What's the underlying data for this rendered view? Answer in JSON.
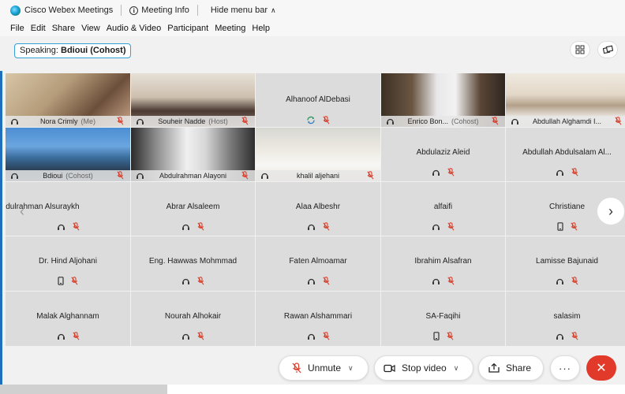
{
  "window": {
    "app_title": "Cisco Webex Meetings",
    "meeting_info_label": "Meeting Info",
    "hide_menu_label": "Hide menu bar"
  },
  "menu": {
    "items": [
      "File",
      "Edit",
      "Share",
      "View",
      "Audio & Video",
      "Participant",
      "Meeting",
      "Help"
    ]
  },
  "speaking": {
    "prefix": "Speaking:",
    "name": "Bdioui (Cohost)"
  },
  "participants": [
    {
      "name": "Nora Crimly",
      "role": "(Me)",
      "video": true,
      "left_icon": "audio-icon"
    },
    {
      "name": "Souheir Nadde",
      "role": "(Host)",
      "video": true,
      "left_icon": "audio-icon"
    },
    {
      "name": "Alhanoof AlDebasi",
      "role": "",
      "video": false,
      "device": "sync-icon"
    },
    {
      "name": "Enrico Bon...",
      "role": "(Cohost)",
      "video": true,
      "left_icon": "audio-icon"
    },
    {
      "name": "Abdullah Alghamdi I...",
      "role": "",
      "video": true,
      "left_icon": "audio-icon"
    },
    {
      "name": "Bdioui",
      "role": "(Cohost)",
      "video": true,
      "left_icon": "audio-icon"
    },
    {
      "name": "Abdulrahman Alayoni",
      "role": "",
      "video": true,
      "left_icon": "audio-icon"
    },
    {
      "name": "khalil aljehani",
      "role": "",
      "video": true,
      "left_icon": "audio-icon"
    },
    {
      "name": "Abdulaziz Aleid",
      "role": "",
      "video": false,
      "device": "audio-icon"
    },
    {
      "name": "Abdullah Abdulsalam Al...",
      "role": "",
      "video": false,
      "device": "audio-icon"
    },
    {
      "name": "Abdulrahman Alsuraykh",
      "role": "",
      "video": false,
      "device": "audio-icon"
    },
    {
      "name": "Abrar Alsaleem",
      "role": "",
      "video": false,
      "device": "audio-icon"
    },
    {
      "name": "Alaa Albeshr",
      "role": "",
      "video": false,
      "device": "audio-icon"
    },
    {
      "name": "alfaifi",
      "role": "",
      "video": false,
      "device": "audio-icon"
    },
    {
      "name": "Christiane",
      "role": "",
      "video": false,
      "device": "mobile-icon"
    },
    {
      "name": "Dr. Hind Aljohani",
      "role": "",
      "video": false,
      "device": "mobile-icon"
    },
    {
      "name": "Eng. Hawwas Mohmmad",
      "role": "",
      "video": false,
      "device": "audio-icon"
    },
    {
      "name": "Faten Almoamar",
      "role": "",
      "video": false,
      "device": "audio-icon"
    },
    {
      "name": "Ibrahim Alsafran",
      "role": "",
      "video": false,
      "device": "audio-icon"
    },
    {
      "name": "Lamisse Bajunaid",
      "role": "",
      "video": false,
      "device": "audio-icon"
    },
    {
      "name": "Malak Alghannam",
      "role": "",
      "video": false,
      "device": "audio-icon"
    },
    {
      "name": "Nourah Alhokair",
      "role": "",
      "video": false,
      "device": "audio-icon"
    },
    {
      "name": "Rawan Alshammari",
      "role": "",
      "video": false,
      "device": "audio-icon"
    },
    {
      "name": "SA-Faqihi",
      "role": "",
      "video": false,
      "device": "mobile-icon"
    },
    {
      "name": "salasim",
      "role": "",
      "video": false,
      "device": "audio-icon"
    }
  ],
  "controls": {
    "unmute_label": "Unmute",
    "stop_video_label": "Stop video",
    "share_label": "Share",
    "more_label": "···"
  },
  "colors": {
    "accent": "#33a1d6",
    "muted_red": "#d8412e",
    "leave_red": "#e13a2a"
  }
}
